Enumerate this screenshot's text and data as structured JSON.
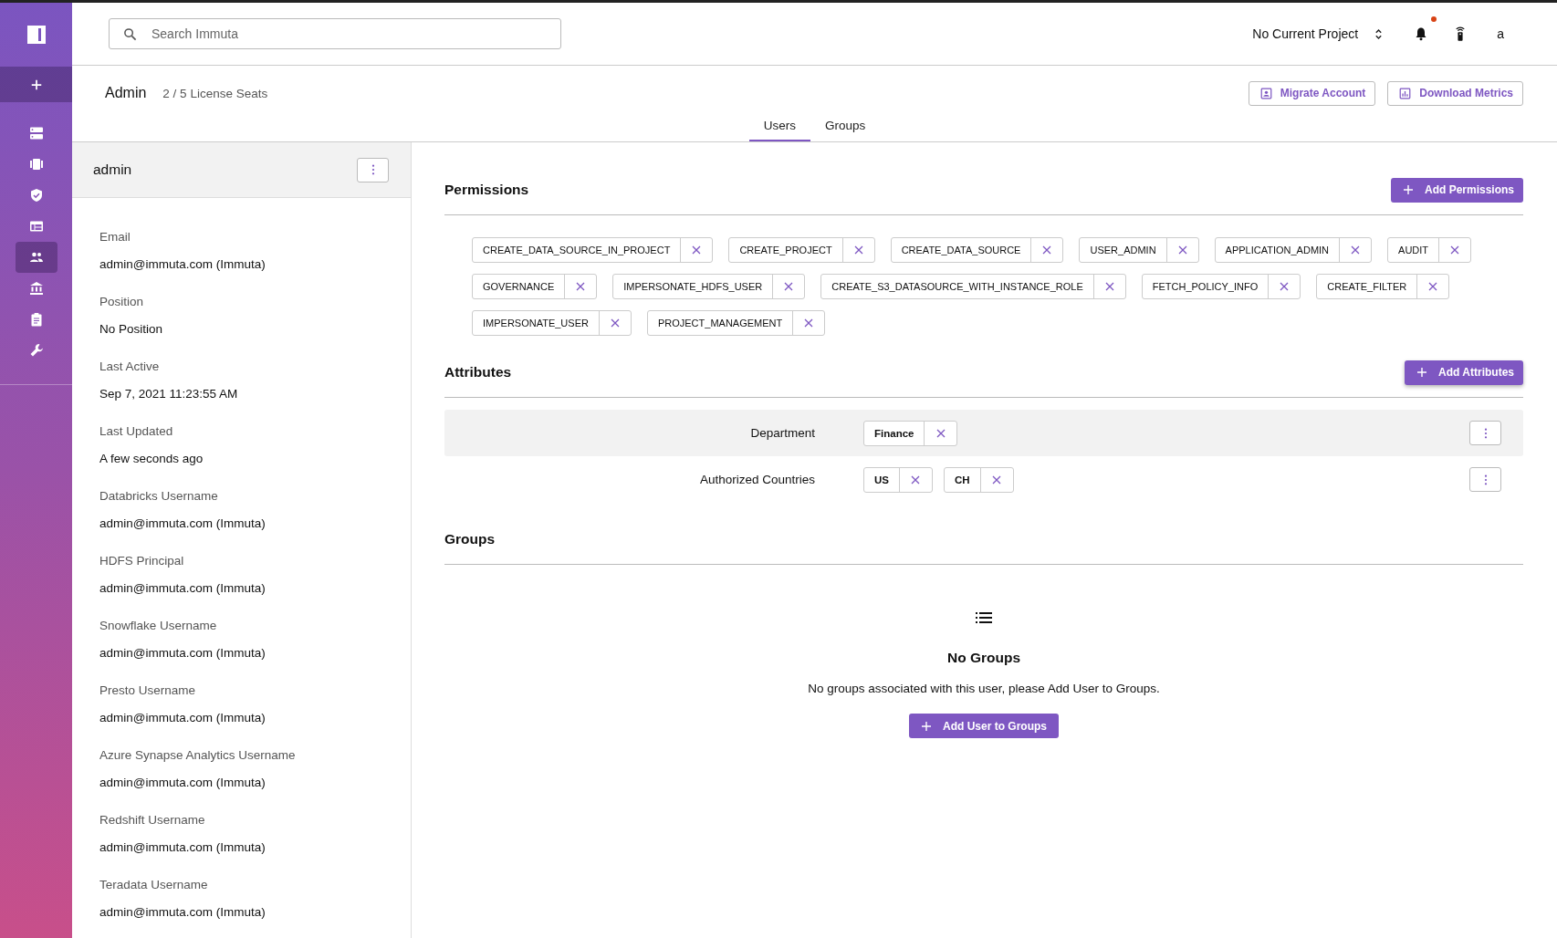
{
  "sidebar": {
    "items": [
      {
        "selected": false
      },
      {
        "selected": false
      },
      {
        "selected": false
      },
      {
        "selected": false
      },
      {
        "selected": true
      },
      {
        "selected": false
      },
      {
        "selected": false
      },
      {
        "selected": false
      }
    ]
  },
  "search": {
    "placeholder": "Search Immuta"
  },
  "project": {
    "label": "No Current Project"
  },
  "notifications": {
    "unread": true
  },
  "user": {
    "initial": "a"
  },
  "page": {
    "title": "Admin",
    "seats": "2 / 5 License Seats"
  },
  "actions": [
    "Migrate Account",
    "Download Metrics"
  ],
  "tabs": [
    {
      "label": "Users",
      "selected": true
    },
    {
      "label": "Groups",
      "selected": false
    }
  ],
  "profile": {
    "name": "admin",
    "fields": [
      {
        "label": "Email",
        "value": "admin@immuta.com (Immuta)"
      },
      {
        "label": "Position",
        "value": "No Position"
      },
      {
        "label": "Last Active",
        "value": "Sep 7, 2021 11:23:55 AM"
      },
      {
        "label": "Last Updated",
        "value": "A few seconds ago"
      },
      {
        "label": "Databricks Username",
        "value": "admin@immuta.com (Immuta)"
      },
      {
        "label": "HDFS Principal",
        "value": "admin@immuta.com (Immuta)"
      },
      {
        "label": "Snowflake Username",
        "value": "admin@immuta.com (Immuta)"
      },
      {
        "label": "Presto Username",
        "value": "admin@immuta.com (Immuta)"
      },
      {
        "label": "Azure Synapse Analytics Username",
        "value": "admin@immuta.com (Immuta)"
      },
      {
        "label": "Redshift Username",
        "value": "admin@immuta.com (Immuta)"
      },
      {
        "label": "Teradata Username",
        "value": "admin@immuta.com (Immuta)"
      }
    ]
  },
  "permissions": {
    "title": "Permissions",
    "button": "Add Permissions",
    "items": [
      "CREATE_DATA_SOURCE_IN_PROJECT",
      "CREATE_PROJECT",
      "CREATE_DATA_SOURCE",
      "USER_ADMIN",
      "APPLICATION_ADMIN",
      "AUDIT",
      "GOVERNANCE",
      "IMPERSONATE_HDFS_USER",
      "CREATE_S3_DATASOURCE_WITH_INSTANCE_ROLE",
      "FETCH_POLICY_INFO",
      "CREATE_FILTER",
      "IMPERSONATE_USER",
      "PROJECT_MANAGEMENT"
    ]
  },
  "attributes": {
    "title": "Attributes",
    "button": "Add Attributes",
    "rows": [
      {
        "name": "Department",
        "values": [
          "Finance"
        ],
        "highlighted": true
      },
      {
        "name": "Authorized Countries",
        "values": [
          "US",
          "CH"
        ],
        "highlighted": false
      }
    ]
  },
  "groups": {
    "title": "Groups",
    "empty_title": "No Groups",
    "empty_text": "No groups associated with this user, please Add User to Groups.",
    "button": "Add User to Groups"
  }
}
